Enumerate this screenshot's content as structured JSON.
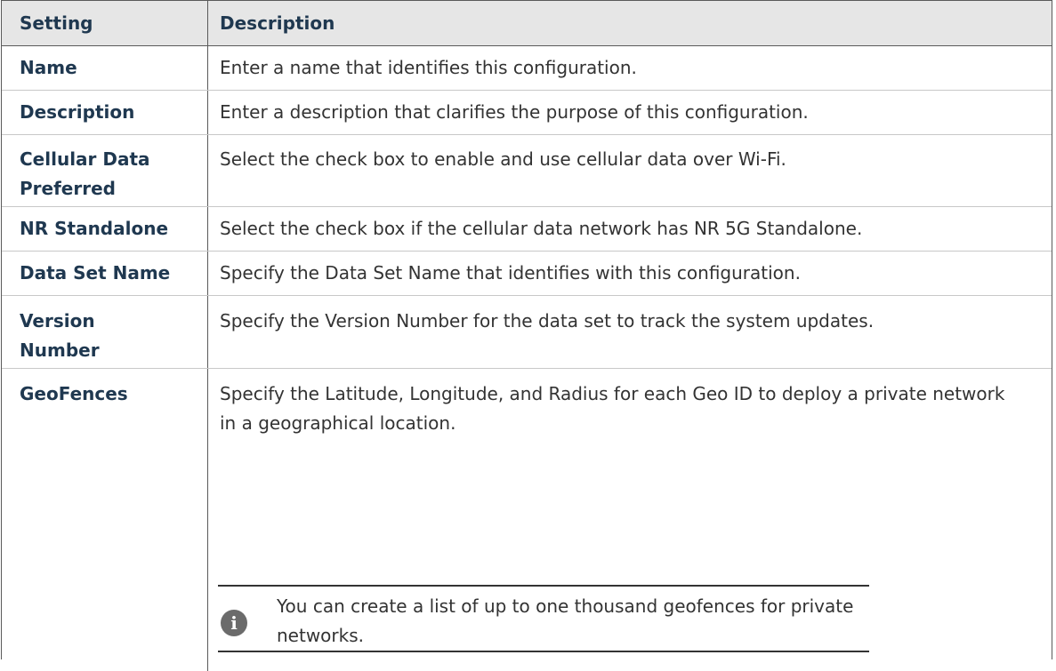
{
  "table": {
    "header": {
      "setting": "Setting",
      "description": "Description"
    },
    "rows": [
      {
        "setting": "Name",
        "description": "Enter a name that identifies this configuration."
      },
      {
        "setting": "Description",
        "description": "Enter a description that clarifies the purpose of this configuration."
      },
      {
        "setting": "Cellular Data Preferred",
        "description": "Select the check box to enable and use cellular data over Wi-Fi."
      },
      {
        "setting": "NR Standalone",
        "description": "Select the check box if the cellular data network has NR 5G Standalone."
      },
      {
        "setting": "Data Set Name",
        "description": "Specify the Data Set Name that identifies with this configuration."
      },
      {
        "setting": "Version Number",
        "description": "Specify the Version Number for the data set to track the system updates."
      },
      {
        "setting": "GeoFences",
        "description": "Specify the Latitude, Longitude, and Radius for each Geo ID to deploy a private network in a geographical location."
      }
    ],
    "note": {
      "icon": "info-icon",
      "icon_glyph": "i",
      "text": "You can create a list of up to one thousand geofences for private networks."
    }
  }
}
